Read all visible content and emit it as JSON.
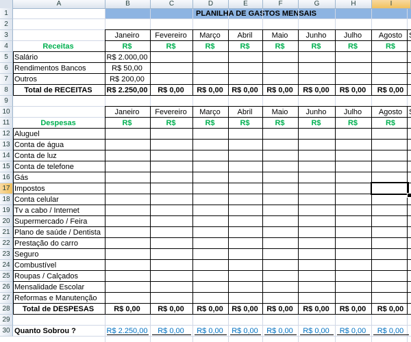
{
  "title": "PLANILHA DE GASTOS MENSAIS",
  "columns": [
    "A",
    "B",
    "C",
    "D",
    "E",
    "F",
    "G",
    "H",
    "I"
  ],
  "selected_column": "I",
  "selected_row": 17,
  "row_numbers": [
    1,
    2,
    3,
    4,
    5,
    6,
    7,
    8,
    9,
    10,
    11,
    12,
    13,
    14,
    15,
    16,
    17,
    18,
    19,
    20,
    21,
    22,
    23,
    24,
    25,
    26,
    27,
    28,
    29,
    30
  ],
  "months": [
    "Janeiro",
    "Fevereiro",
    "Março",
    "Abril",
    "Maio",
    "Junho",
    "Julho",
    "Agosto",
    "S"
  ],
  "currency_symbol": "R$",
  "receitas": {
    "label": "Receitas",
    "items": [
      {
        "name": "Salário",
        "janeiro": "R$ 2.000,00"
      },
      {
        "name": "Rendimentos Bancos",
        "janeiro": "R$ 50,00"
      },
      {
        "name": "Outros",
        "janeiro": "R$ 200,00"
      }
    ],
    "total_label": "Total de RECEITAS",
    "totals": [
      "R$ 2.250,00",
      "R$ 0,00",
      "R$ 0,00",
      "R$ 0,00",
      "R$ 0,00",
      "R$ 0,00",
      "R$ 0,00",
      "R$ 0,00"
    ]
  },
  "despesas": {
    "label": "Despesas",
    "items": [
      "Aluguel",
      "Conta de água",
      "Conta de luz",
      "Conta de telefone",
      "Gás",
      "Impostos",
      "Conta celular",
      "Tv a cabo / Internet",
      "Supermercado / Feira",
      "Plano de saúde / Dentista",
      "Prestação do carro",
      "Seguro",
      "Combustível",
      "Roupas / Calçados",
      "Mensalidade Escolar",
      "Reformas e Manutenção"
    ],
    "total_label": "Total de DESPESAS",
    "totals": [
      "R$ 0,00",
      "R$ 0,00",
      "R$ 0,00",
      "R$ 0,00",
      "R$ 0,00",
      "R$ 0,00",
      "R$ 0,00",
      "R$ 0,00"
    ]
  },
  "quanto_sobrou": {
    "label": "Quanto Sobrou  ?",
    "values": [
      "R$ 2.250,00",
      "R$ 0,00",
      "R$ 0,00",
      "R$ 0,00",
      "R$ 0,00",
      "R$ 0,00",
      "R$ 0,00",
      "R$ 0,00"
    ]
  },
  "colors": {
    "title_band": "#8db4e2",
    "green": "#00b050",
    "blue": "#0070c0",
    "gridline": "#d0d7e5"
  }
}
